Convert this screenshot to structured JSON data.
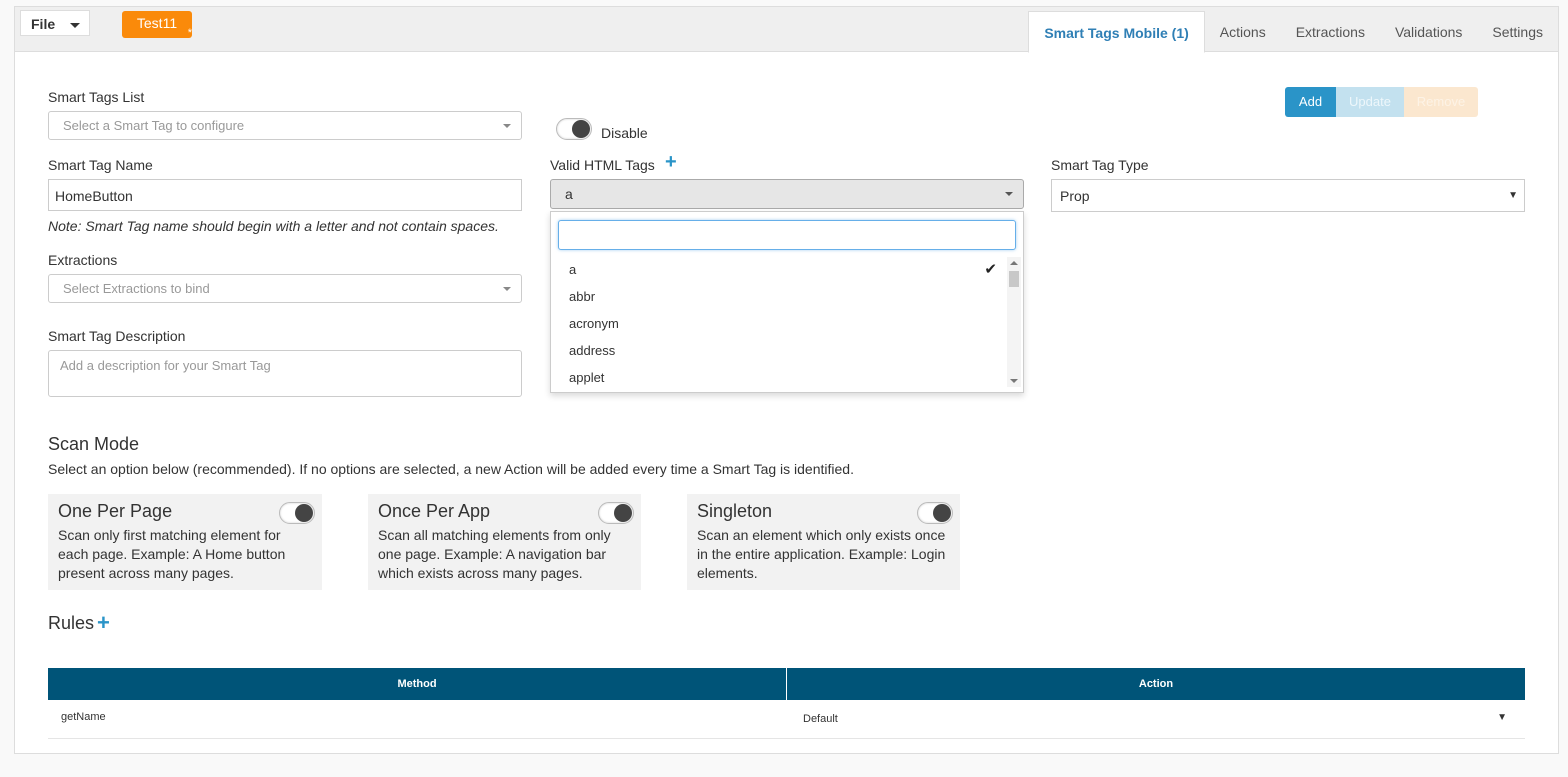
{
  "topbar": {
    "file_label": "File",
    "project_tab": "Test11",
    "project_modified": "*",
    "tabs": [
      {
        "label": "Smart Tags Mobile (1)",
        "active": true
      },
      {
        "label": "Actions"
      },
      {
        "label": "Extractions"
      },
      {
        "label": "Validations"
      },
      {
        "label": "Settings"
      }
    ]
  },
  "form": {
    "smart_tags_list_label": "Smart Tags List",
    "smart_tags_list_placeholder": "Select a Smart Tag to configure",
    "disable_label": "Disable",
    "name_label": "Smart Tag Name",
    "name_value": "HomeButton",
    "name_note": "Note: Smart Tag name should begin with a letter and not contain spaces.",
    "valid_html_label": "Valid HTML Tags",
    "valid_html_value": "a",
    "type_label": "Smart Tag Type",
    "type_value": "Prop",
    "extractions_label": "Extractions",
    "extractions_placeholder": "Select Extractions to bind",
    "description_label": "Smart Tag Description",
    "description_placeholder": "Add a description for your Smart Tag"
  },
  "buttons": {
    "add": "Add",
    "update": "Update",
    "remove": "Remove"
  },
  "dropdown": {
    "search_value": "",
    "items": [
      "a",
      "abbr",
      "acronym",
      "address",
      "applet"
    ],
    "selected": "a"
  },
  "scan_mode": {
    "title": "Scan Mode",
    "description": "Select an option below (recommended). If no options are selected, a new Action will be added every time a Smart Tag is identified.",
    "options": [
      {
        "title": "One Per Page",
        "desc": "Scan only first matching element for each page. Example: A Home button present across many pages."
      },
      {
        "title": "Once Per App",
        "desc": "Scan all matching elements from only one page. Example: A navigation bar which exists across many pages."
      },
      {
        "title": "Singleton",
        "desc": "Scan an element which only exists once in the entire application. Example: Login elements."
      }
    ]
  },
  "rules": {
    "title": "Rules",
    "columns": [
      "Method",
      "Action"
    ],
    "rows": [
      {
        "method": "getName",
        "action": "Default"
      }
    ]
  },
  "colors": {
    "accent": "#2a94c8",
    "table_header": "#005478",
    "project_tab": "#fa8a0a"
  }
}
